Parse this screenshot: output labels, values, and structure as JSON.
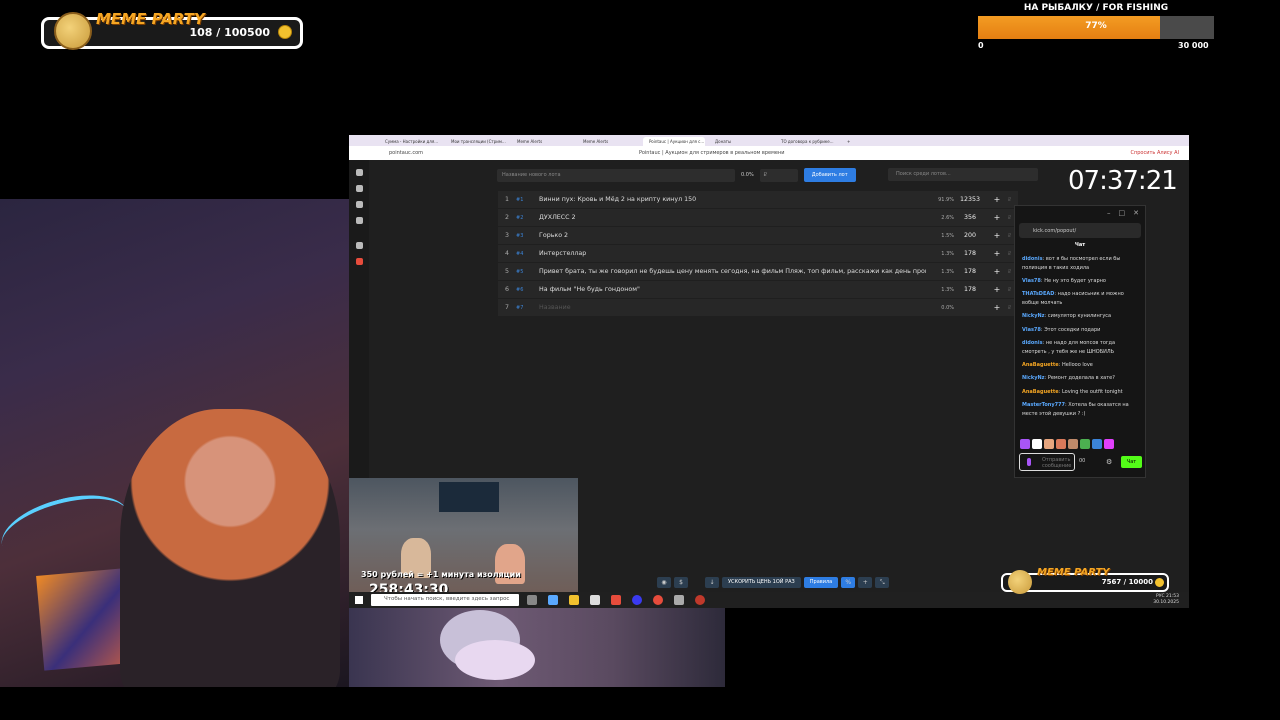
{
  "meme_widget": {
    "title": "MEME PARTY",
    "count": "108 / 100500"
  },
  "goal": {
    "title": "НА РЫБАЛКУ / FOR FISHING",
    "percent": "77%",
    "progress": 0.77,
    "min": "0",
    "max": "30 000"
  },
  "browser": {
    "tabs": [
      "Сумма - Настройки для...",
      "Мои трансляции (Стрим...",
      "Meme Alerts",
      "Meme Alerts",
      "Pointauc | Аукцион для с...",
      "Донаты",
      "ТО договора к рубрике...",
      "+"
    ],
    "url": "pointauc.com",
    "page_title": "Pointauc | Аукцион для стримеров в реальном времени",
    "ai_button": "Спросить Алису AI"
  },
  "auction": {
    "new_lot_placeholder": "Название нового лота",
    "pct": "0.0%",
    "price_placeholder": "₽",
    "add_button": "Добавить лот",
    "search_placeholder": "Поиск среди лотов...",
    "lots": [
      {
        "num": "1",
        "id": "#1",
        "name": "Винни пух: Кровь и Мёд 2 на крипту кинул 150",
        "pct": "91.9%",
        "value": "12353"
      },
      {
        "num": "2",
        "id": "#2",
        "name": "ДУХЛЕСС 2",
        "pct": "2.6%",
        "value": "356"
      },
      {
        "num": "3",
        "id": "#3",
        "name": "Горько 2",
        "pct": "1.5%",
        "value": "200"
      },
      {
        "num": "4",
        "id": "#4",
        "name": "Интерстеллар",
        "pct": "1.3%",
        "value": "178"
      },
      {
        "num": "5",
        "id": "#5",
        "name": "Привет братa, ты же говорил не будешь цену менять сегодня, на фильм Пляж, топ фильм, расскажи как день прош",
        "pct": "1.3%",
        "value": "178"
      },
      {
        "num": "6",
        "id": "#6",
        "name": "На фильм \"Не будь гондоном\"",
        "pct": "1.3%",
        "value": "178"
      },
      {
        "num": "7",
        "id": "#7",
        "name": "Название",
        "pct": "0.0%",
        "value": ""
      }
    ]
  },
  "clock": "07:37:21",
  "chat": {
    "url": "kick.com/popout/",
    "title": "Чат",
    "messages": [
      {
        "user": "didonis",
        "color": "#5aa9ff",
        "text": "вот я бы посмотрел если бы полиэция в таких ходила"
      },
      {
        "user": "Vlas78",
        "color": "#5aa9ff",
        "text": "Не ну это будет угарно"
      },
      {
        "user": "THATsDEAD",
        "color": "#5aa9ff",
        "text": "надо насисьник и можно вобще молчать"
      },
      {
        "user": "NickyNz",
        "color": "#5aa9ff",
        "text": "симулятор кунилингуса"
      },
      {
        "user": "Vlas78",
        "color": "#5aa9ff",
        "text": "Этот соседки подари"
      },
      {
        "user": "didonis",
        "color": "#5aa9ff",
        "text": "не надо для мопсов тогда смотреть , у тебя же не ШНОБИЛЬ"
      },
      {
        "user": "AnaBaguette",
        "color": "#f5a623",
        "text": "Helloоо love"
      },
      {
        "user": "NickyNz",
        "color": "#5aa9ff",
        "text": "Ремонт доделала в хате?"
      },
      {
        "user": "AnaBaguette",
        "color": "#f5a623",
        "text": "Loving the outfit tonight"
      },
      {
        "user": "MasterTony777",
        "color": "#5aa9ff",
        "text": "Хотела бы оказатся на месте этой девушки ? :)"
      }
    ],
    "input_placeholder": "Отправить сообщение",
    "points": "00",
    "send_button": "Чат"
  },
  "mini_stream": {
    "caption": "350 рублей = +1 минута изоляции",
    "timer": "258:43:30"
  },
  "bottom_tools": {
    "speed_label": "УСКОРИТЬ ЦЕНЬ 1ОЙ РАЗ",
    "rules_label": "Правила"
  },
  "taskbar": {
    "search_placeholder": "Чтобы начать поиск, введите здесь запрос",
    "lang": "РУС",
    "time": "21:53",
    "date": "30.10.2025"
  },
  "meme_small": {
    "title": "MEME PARTY",
    "count": "7567 / 10000"
  }
}
